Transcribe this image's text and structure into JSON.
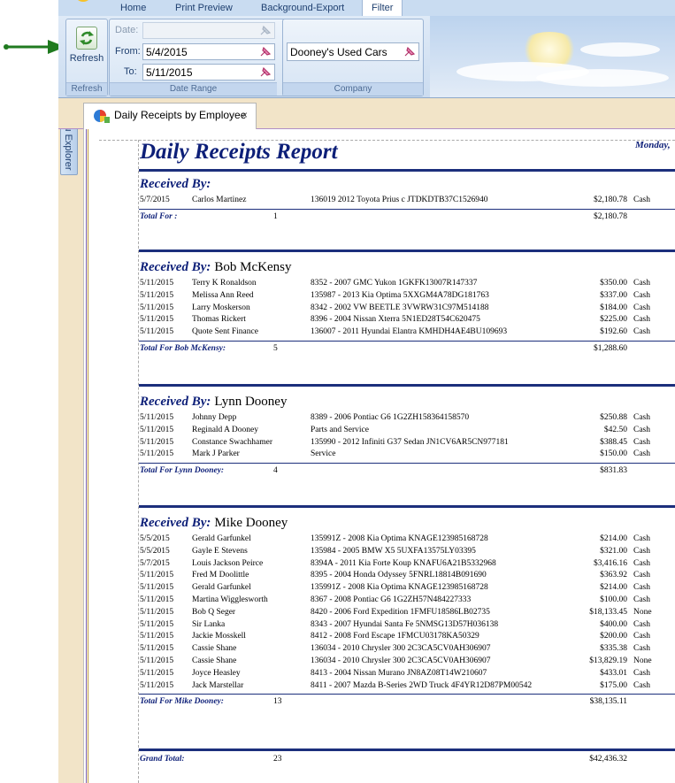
{
  "ribbon": {
    "tabs": [
      "Home",
      "Print Preview",
      "Background-Export",
      "Filter"
    ],
    "active_tab": "Filter",
    "refresh_label": "Refresh",
    "refresh_group": "Refresh",
    "date_label": "Date:",
    "from_label": "From:",
    "from_value": "5/4/2015",
    "to_label": "To:",
    "to_value": "5/11/2015",
    "date_range_group": "Date Range",
    "company_value": "Dooney's Used Cars",
    "company_group": "Company"
  },
  "doc_tab": {
    "title": "Daily Receipts by Employee",
    "close": "×"
  },
  "side_panel": {
    "label": "Menu Explorer"
  },
  "report": {
    "title": "Daily Receipts Report",
    "date_partial": "Monday,",
    "received_by_label": "Received By:",
    "groups": [
      {
        "name": "",
        "rows": [
          {
            "date": "5/7/2015",
            "customer": "Carlos   Martinez",
            "item": "136019 2012 Toyota Prius c JTDKDTB37C1526940",
            "amount": "$2,180.78",
            "method": "Cash"
          }
        ],
        "total_label": "Total For :",
        "count": "1",
        "total": "$2,180.78"
      },
      {
        "name": "Bob McKensy",
        "rows": [
          {
            "date": "5/11/2015",
            "customer": "Terry K Ronaldson",
            "item": "8352 - 2007 GMC Yukon 1GKFK13007R147337",
            "amount": "$350.00",
            "method": "Cash"
          },
          {
            "date": "5/11/2015",
            "customer": "Melissa Ann Reed",
            "item": "135987 - 2013 Kia Optima 5XXGM4A78DG181763",
            "amount": "$337.00",
            "method": "Cash"
          },
          {
            "date": "5/11/2015",
            "customer": "Larry  Moskerson",
            "item": "8342 - 2002 VW BEETLE 3VWRW31C97M514188",
            "amount": "$184.00",
            "method": "Cash"
          },
          {
            "date": "5/11/2015",
            "customer": "Thomas  Rickert",
            "item": "8396 - 2004 Nissan Xterra 5N1ED28T54C620475",
            "amount": "$225.00",
            "method": "Cash"
          },
          {
            "date": "5/11/2015",
            "customer": "Quote  Sent Finance",
            "item": "136007 - 2011 Hyundai Elantra KMHDH4AE4BU109693",
            "amount": "$192.60",
            "method": "Cash"
          }
        ],
        "total_label": "Total For Bob McKensy:",
        "count": "5",
        "total": "$1,288.60"
      },
      {
        "name": "Lynn Dooney",
        "rows": [
          {
            "date": "5/11/2015",
            "customer": "Johnny  Depp",
            "item": "8389 - 2006 Pontiac G6 1G2ZH158364158570",
            "amount": "$250.88",
            "method": "Cash"
          },
          {
            "date": "5/11/2015",
            "customer": "Reginald A Dooney",
            "item": "Parts and Service",
            "amount": "$42.50",
            "method": "Cash"
          },
          {
            "date": "5/11/2015",
            "customer": "Constance  Swachhamer",
            "item": "135990 - 2012 Infiniti G37 Sedan JN1CV6AR5CN977181",
            "amount": "$388.45",
            "method": "Cash"
          },
          {
            "date": "5/11/2015",
            "customer": "Mark J Parker",
            "item": "Service",
            "amount": "$150.00",
            "method": "Cash"
          }
        ],
        "total_label": "Total For Lynn Dooney:",
        "count": "4",
        "total": "$831.83"
      },
      {
        "name": "Mike Dooney",
        "rows": [
          {
            "date": "5/5/2015",
            "customer": "Gerald  Garfunkel",
            "item": "135991Z - 2008 Kia Optima KNAGE123985168728",
            "amount": "$214.00",
            "method": "Cash"
          },
          {
            "date": "5/5/2015",
            "customer": "Gayle E Stevens",
            "item": "135984 - 2005 BMW X5 5UXFA13575LY03395",
            "amount": "$321.00",
            "method": "Cash"
          },
          {
            "date": "5/7/2015",
            "customer": "Louis  Jackson Peirce",
            "item": "8394A - 2011 Kia Forte Koup KNAFU6A21B5332968",
            "amount": "$3,416.16",
            "method": "Cash"
          },
          {
            "date": "5/11/2015",
            "customer": "Fred M Doolittle",
            "item": "8395 - 2004 Honda Odyssey 5FNRL18814B091690",
            "amount": "$363.92",
            "method": "Cash"
          },
          {
            "date": "5/11/2015",
            "customer": "Gerald  Garfunkel",
            "item": "135991Z - 2008 Kia Optima KNAGE123985168728",
            "amount": "$214.00",
            "method": "Cash"
          },
          {
            "date": "5/11/2015",
            "customer": "Martina  Wigglesworth",
            "item": "8367 - 2008 Pontiac G6 1G2ZH57N484227333",
            "amount": "$100.00",
            "method": "Cash"
          },
          {
            "date": "5/11/2015",
            "customer": "Bob Q Seger",
            "item": "8420 - 2006 Ford Expedition 1FMFU18586LB02735",
            "amount": "$18,133.45",
            "method": "None"
          },
          {
            "date": "5/11/2015",
            "customer": "Sir  Lanka",
            "item": "8343 - 2007 Hyundai Santa Fe 5NMSG13D57H036138",
            "amount": "$400.00",
            "method": "Cash"
          },
          {
            "date": "5/11/2015",
            "customer": "Jackie  Mosskell",
            "item": "8412 - 2008 Ford Escape 1FMCU03178KA50329",
            "amount": "$200.00",
            "method": "Cash"
          },
          {
            "date": "5/11/2015",
            "customer": "Cassie  Shane",
            "item": "136034 - 2010 Chrysler 300 2C3CA5CV0AH306907",
            "amount": "$335.38",
            "method": "Cash"
          },
          {
            "date": "5/11/2015",
            "customer": "Cassie  Shane",
            "item": "136034 - 2010 Chrysler 300 2C3CA5CV0AH306907",
            "amount": "$13,829.19",
            "method": "None"
          },
          {
            "date": "5/11/2015",
            "customer": "Joyce  Heasley",
            "item": "8413 - 2004 Nissan Murano JN8AZ08T14W210607",
            "amount": "$433.01",
            "method": "Cash"
          },
          {
            "date": "5/11/2015",
            "customer": "Jack  Marstellar",
            "item": "8411 - 2007 Mazda B-Series 2WD Truck 4F4YR12D87PM00542",
            "amount": "$175.00",
            "method": "Cash"
          }
        ],
        "total_label": "Total For Mike Dooney:",
        "count": "13",
        "total": "$38,135.11"
      }
    ],
    "grand_total_label": "Grand Total:",
    "grand_count": "23",
    "grand_total": "$42,436.32"
  }
}
